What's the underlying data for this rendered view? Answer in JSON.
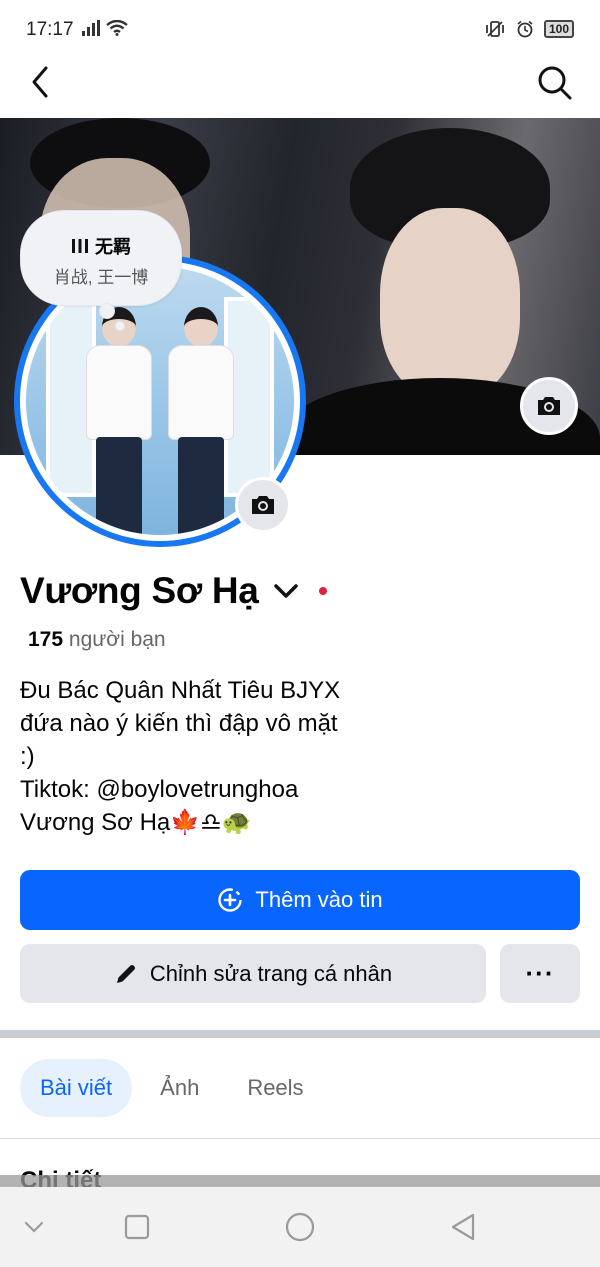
{
  "status_bar": {
    "time": "17:17",
    "battery": "100"
  },
  "profile": {
    "name": "Vương Sơ Hạ",
    "friends_count": "175",
    "friends_label": "người bạn",
    "bio_lines": [
      "Đu Bác Quân Nhất Tiêu BJYX",
      "đứa nào ý kiến thì đập vô mặt",
      ":)",
      "Tiktok: @boylovetrunghoa",
      "Vương Sơ Hạ🍁♎🐢"
    ]
  },
  "note": {
    "song_title": "无羁",
    "artists": "肖战, 王一博"
  },
  "buttons": {
    "add_to_story": "Thêm vào tin",
    "edit_profile": "Chỉnh sửa trang cá nhân",
    "more": "···"
  },
  "tabs": [
    {
      "label": "Bài viết",
      "active": true
    },
    {
      "label": "Ảnh",
      "active": false
    },
    {
      "label": "Reels",
      "active": false
    }
  ],
  "details": {
    "title": "Chi tiết"
  },
  "colors": {
    "primary": "#0866ff",
    "avatar_ring": "#1877f2",
    "secondary_button": "#e4e6eb",
    "tab_active_bg": "#e7f0fd",
    "online_dot": "#e41e3f"
  },
  "icons": {
    "back": "arrow-left-icon",
    "search": "search-icon",
    "camera": "camera-icon",
    "chevron": "chevron-down-icon",
    "add_story": "add-story-icon",
    "edit": "pencil-icon",
    "music": "music-bars-icon"
  }
}
